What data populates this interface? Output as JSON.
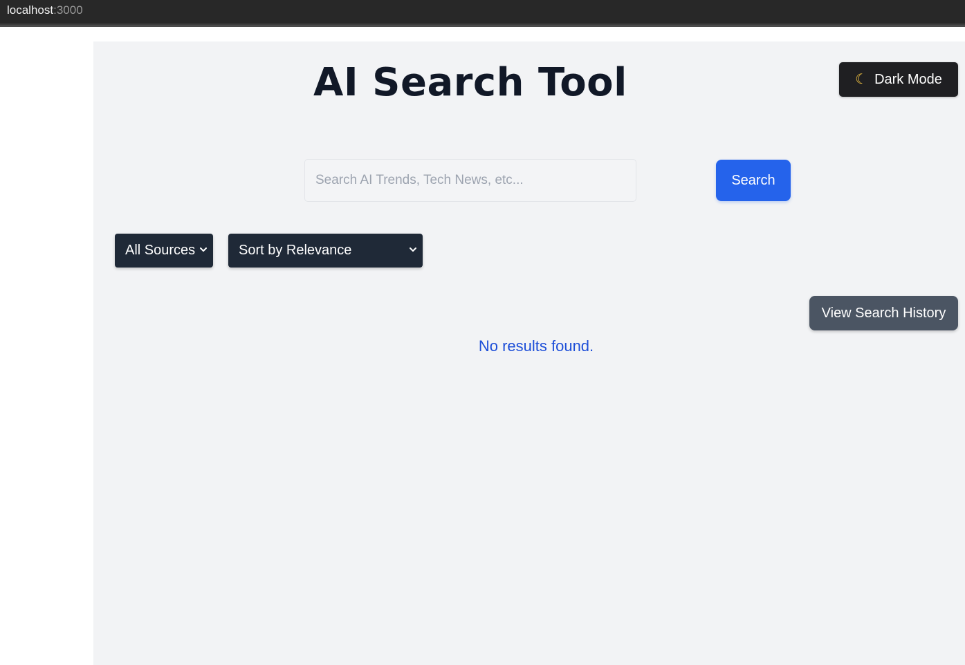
{
  "browser": {
    "url_host": "localhost",
    "url_port": ":3000"
  },
  "header": {
    "title": "AI Search Tool",
    "dark_mode_icon": "moon-icon",
    "dark_mode_label": "Dark Mode"
  },
  "search": {
    "placeholder": "Search AI Trends, Tech News, etc...",
    "value": "",
    "button_label": "Search"
  },
  "filters": {
    "source_selected": "All Sources",
    "sort_selected": "Sort by Relevance"
  },
  "history": {
    "button_label": "View Search History"
  },
  "results": {
    "empty_message": "No results found."
  },
  "colors": {
    "primary_blue": "#2563eb",
    "dark_select": "#1f2937",
    "history_gray": "#4b5563",
    "app_background": "#f2f3f5",
    "message_blue": "#1d4ed8"
  }
}
